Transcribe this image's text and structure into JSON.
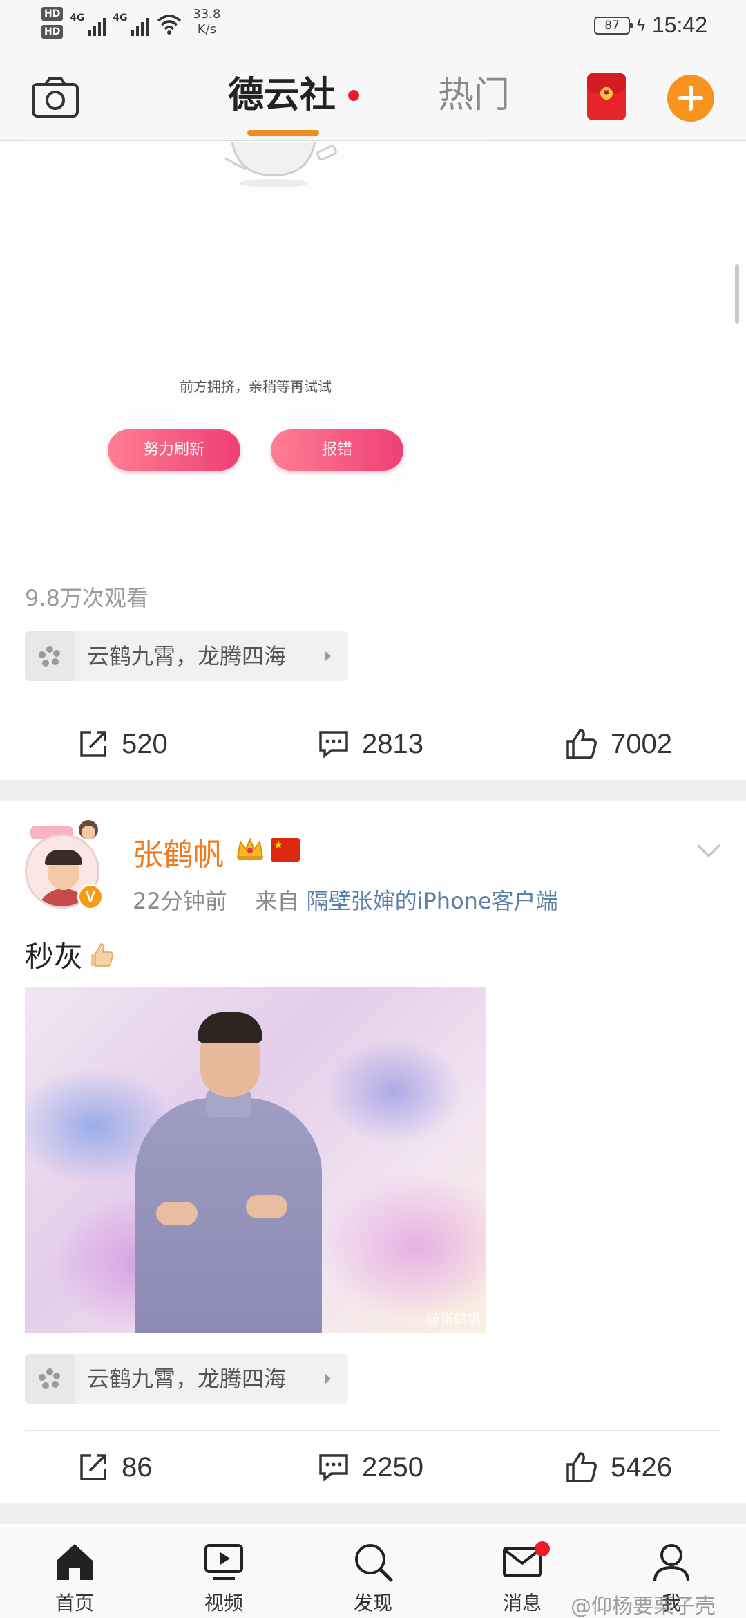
{
  "status_bar": {
    "hd1": "HD",
    "hd2": "HD",
    "sim1_network": "4G",
    "sim2_network": "4G",
    "speed_value": "33.8",
    "speed_unit": "K/s",
    "battery_percent": "87",
    "time": "15:42"
  },
  "top_nav": {
    "tab_active": "德云社",
    "tab_inactive": "热门",
    "redpacket_symbol": "¥",
    "accent_color": "#f08c1c"
  },
  "post1": {
    "error_message": "前方拥挤，亲稍等再试试",
    "refresh_button": "努力刷新",
    "report_button": "报错",
    "views": "9.8万次观看",
    "topic": "云鹤九霄，龙腾四海",
    "shares": "520",
    "comments": "2813",
    "likes": "7002"
  },
  "post2": {
    "username": "张鹤帆",
    "verified_badge": "V",
    "time": "22分钟前",
    "from_label": "来自",
    "source": "隔壁张婶的iPhone客户端",
    "text": "秒灰",
    "image_watermark": "@张鹤帆",
    "topic": "云鹤九霄，龙腾四海",
    "shares": "86",
    "comments": "2250",
    "likes": "5426"
  },
  "bottom_nav": {
    "home": "首页",
    "video": "视频",
    "discover": "发现",
    "messages": "消息",
    "me": "我"
  },
  "watermark": "@仰杨要栗子壳"
}
